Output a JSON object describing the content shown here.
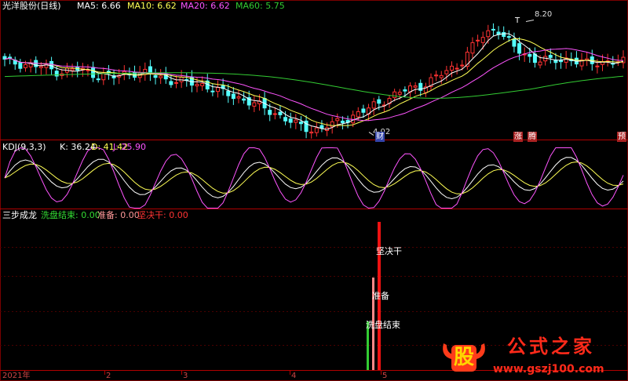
{
  "header": {
    "title": "光洋股份(日线)",
    "ma5": "MA5: 6.66",
    "ma10": "MA10: 6.62",
    "ma20": "MA20: 6.62",
    "ma60": "MA60: 5.75"
  },
  "kdj_header": {
    "title": "KDJ(9,3,3)",
    "k": "K: 36.24",
    "d": "D: 41.42",
    "j": "J: 25.90"
  },
  "ind_header": {
    "title": "三步成龙",
    "s1": "洗盘结束: 0.00",
    "s2": "准备: 0.00",
    "s3": "坚决干: 0.00"
  },
  "markers": {
    "high": "8.20",
    "low": "4.02",
    "t_mark": "T",
    "cai": "财",
    "zhang": "涨",
    "teng": "腾",
    "yu": "预"
  },
  "bar_labels": {
    "wash": "洗盘结束",
    "prepare": "准备",
    "go": "坚决干"
  },
  "xaxis": {
    "year": "2021年",
    "m2": "2",
    "m3": "3",
    "m4": "4",
    "m5": "5"
  },
  "watermark": {
    "logo": "股",
    "site_name": "公式之家",
    "url": "www.gszj100.com"
  },
  "colors": {
    "ma5": "#ffffff",
    "ma10": "#ffff55",
    "ma20": "#ff55ff",
    "ma60": "#33cc33",
    "up": "#ff3232",
    "down": "#54ffff",
    "grid": "#7a0000"
  },
  "chart_data": [
    {
      "type": "candlestick",
      "title": "光洋股份(日线)",
      "ylim": [
        3.8,
        8.6
      ],
      "price_close_path": [
        6.7,
        6.6,
        6.5,
        6.3,
        6.4,
        6.2,
        6.1,
        6.3,
        6.2,
        6.0,
        5.9,
        5.8,
        5.5,
        5.3,
        5.0,
        4.7,
        4.3,
        4.1,
        4.3,
        4.6,
        4.9,
        5.3,
        5.6,
        5.8,
        6.2,
        6.6,
        7.5,
        8.0,
        7.2,
        6.8,
        6.7,
        6.8,
        6.6,
        6.7,
        6.66
      ],
      "labels": {
        "high": 8.2,
        "low": 4.02
      },
      "series": [
        {
          "name": "MA5",
          "last": 6.66
        },
        {
          "name": "MA10",
          "last": 6.62
        },
        {
          "name": "MA20",
          "last": 6.62
        },
        {
          "name": "MA60",
          "last": 5.75
        }
      ]
    },
    {
      "type": "line",
      "title": "KDJ(9,3,3)",
      "series": [
        {
          "name": "K",
          "last": 36.24
        },
        {
          "name": "D",
          "last": 41.42
        },
        {
          "name": "J",
          "last": 25.9
        }
      ]
    },
    {
      "type": "bar",
      "title": "三步成龙",
      "categories": [
        "洗盘结束",
        "准备",
        "坚决干"
      ],
      "values": [
        1,
        2,
        3
      ],
      "series": [
        {
          "name": "洗盘结束",
          "last": 0.0
        },
        {
          "name": "准备",
          "last": 0.0
        },
        {
          "name": "坚决干",
          "last": 0.0
        }
      ]
    }
  ]
}
